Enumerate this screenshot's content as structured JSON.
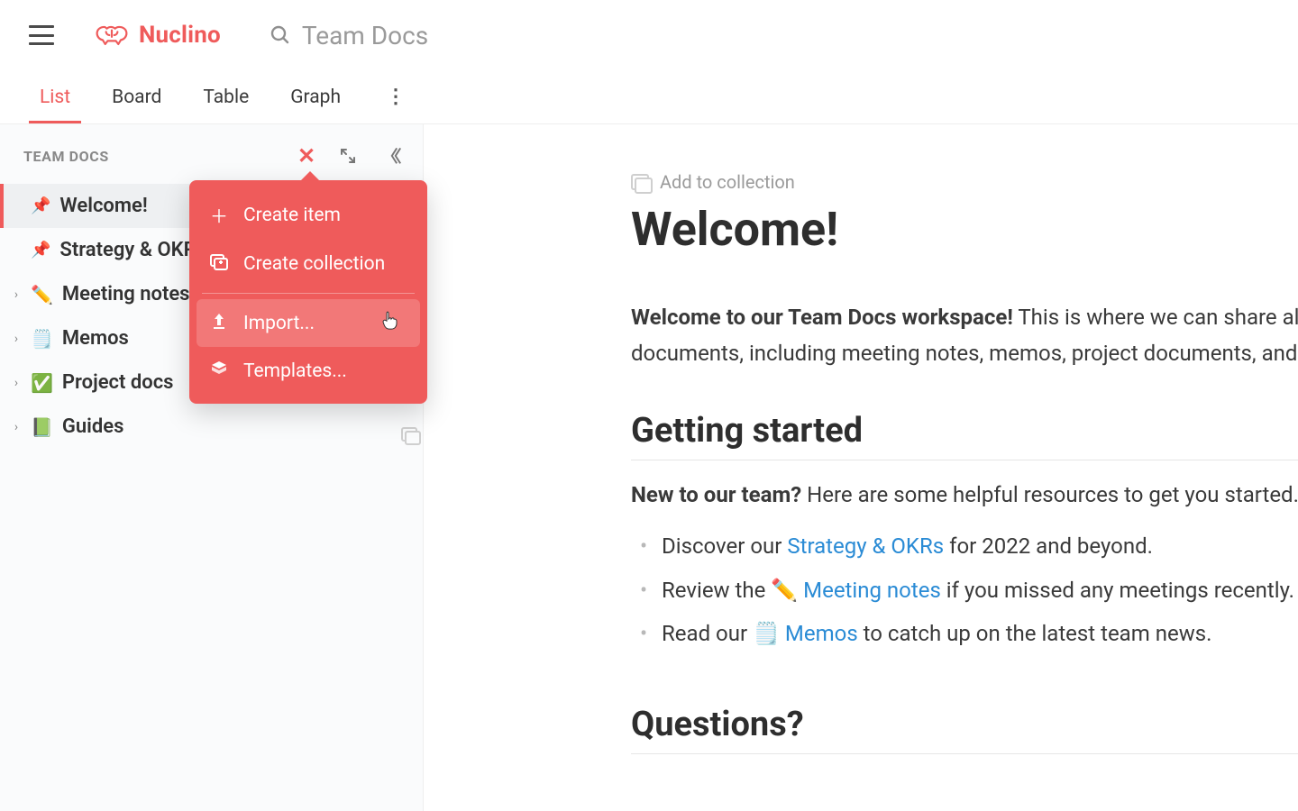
{
  "brand": {
    "name": "Nuclino"
  },
  "search": {
    "placeholder": "Team Docs"
  },
  "views": {
    "tabs": [
      {
        "label": "List",
        "active": true
      },
      {
        "label": "Board",
        "active": false
      },
      {
        "label": "Table",
        "active": false
      },
      {
        "label": "Graph",
        "active": false
      }
    ]
  },
  "sidebar": {
    "title": "TEAM DOCS",
    "items": [
      {
        "icon": "📌",
        "label": "Welcome!",
        "expandable": false,
        "active": true,
        "trailing": false
      },
      {
        "icon": "📌",
        "label": "Strategy & OKRs",
        "expandable": false,
        "active": false,
        "trailing": false
      },
      {
        "icon": "✏️",
        "label": "Meeting notes",
        "expandable": true,
        "active": false,
        "trailing": false
      },
      {
        "icon": "🗒️",
        "label": "Memos",
        "expandable": true,
        "active": false,
        "trailing": false
      },
      {
        "icon": "✅",
        "label": "Project docs",
        "expandable": true,
        "active": false,
        "trailing": true
      },
      {
        "icon": "📗",
        "label": "Guides",
        "expandable": true,
        "active": false,
        "trailing": true
      }
    ]
  },
  "plusmenu": {
    "items": [
      {
        "id": "create-item",
        "label": "Create item",
        "icon": "+"
      },
      {
        "id": "create-collection",
        "label": "Create collection",
        "icon": "⊞"
      },
      {
        "id": "import",
        "label": "Import...",
        "icon": "⬆",
        "hovered": true
      },
      {
        "id": "templates",
        "label": "Templates...",
        "icon": "⧉"
      }
    ]
  },
  "doc": {
    "add_collection": "Add to collection",
    "title": "Welcome!",
    "intro_bold": "Welcome to our Team Docs workspace!",
    "intro_rest": " This is where we can share all kinds of documents, including meeting notes, memos, project documents, and more.",
    "h2a": "Getting started",
    "lead_bold": "New to our team?",
    "lead_rest": " Here are some helpful resources to get you started.",
    "bullets": [
      {
        "pre": "Discover our ",
        "link": "Strategy & OKRs",
        "post": " for 2022 and beyond."
      },
      {
        "pre": "Review the ",
        "emoji": "✏️",
        "link": "Meeting notes",
        "post": " if you missed any meetings recently."
      },
      {
        "pre": "Read our ",
        "emoji": "🗒️",
        "link": "Memos",
        "post": " to catch up on the latest team news."
      }
    ],
    "h2b": "Questions?"
  },
  "colors": {
    "accent": "#ef5b5b",
    "link": "#2a8bd5"
  }
}
